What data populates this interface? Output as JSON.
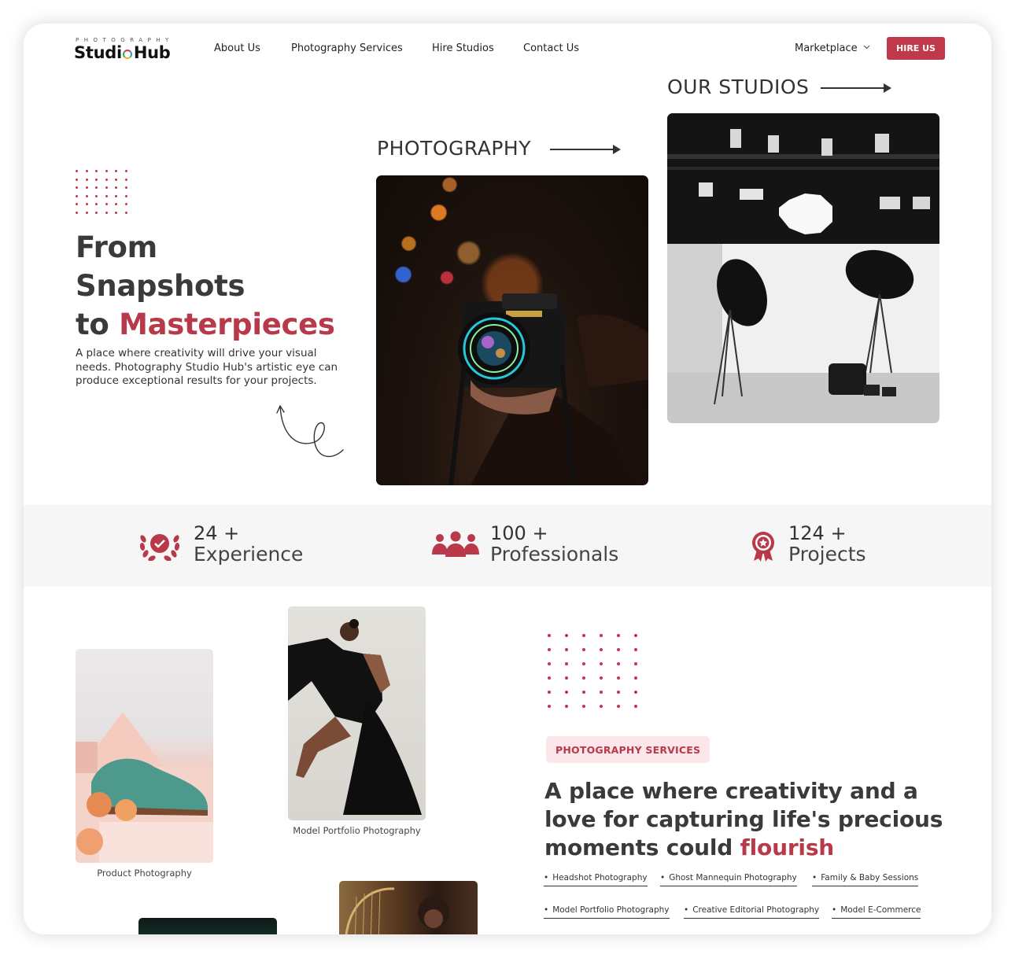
{
  "header": {
    "logo_top": "PHOTOGRAPHY",
    "logo_main_left": "Studi",
    "logo_main_right": "Hub",
    "nav": [
      "About Us",
      "Photography Services",
      "Hire Studios",
      "Contact Us"
    ],
    "marketplace": "Marketplace",
    "hire_label": "HIRE US"
  },
  "hero": {
    "title_line1": "From",
    "title_line2": "Snapshots",
    "title_line3_prefix": "to ",
    "title_line3_accent": "Masterpieces",
    "description": "A place where creativity will drive your visual needs. Photography Studio Hub's artistic eye can produce exceptional results for your projects.",
    "photography_label": "PHOTOGRAPHY",
    "studios_label": "OUR STUDIOS"
  },
  "stats": [
    {
      "num": "24 +",
      "label": "Experience",
      "icon": "laurel-badge-icon"
    },
    {
      "num": "100 +",
      "label": "Professionals",
      "icon": "team-icon"
    },
    {
      "num": "124 +",
      "label": "Projects",
      "icon": "award-ribbon-icon"
    }
  ],
  "gallery": {
    "product_caption": "Product Photography",
    "model_caption": "Model Portfolio Photography"
  },
  "services": {
    "badge": "PHOTOGRAPHY SERVICES",
    "heading_main": "A place where creativity and a love for capturing life's precious moments could ",
    "heading_accent": "flourish",
    "tags_row1": [
      "Headshot Photography",
      "Ghost Mannequin Photography",
      "Family & Baby Sessions"
    ],
    "tags_row2": [
      "Model Portfolio Photography",
      "Creative Editorial Photography",
      "Model E-Commerce"
    ]
  },
  "colors": {
    "accent": "#c0394a",
    "accent_text": "#b8394a",
    "badge_bg": "#fbe7ea",
    "band": "#f6f6f6"
  }
}
